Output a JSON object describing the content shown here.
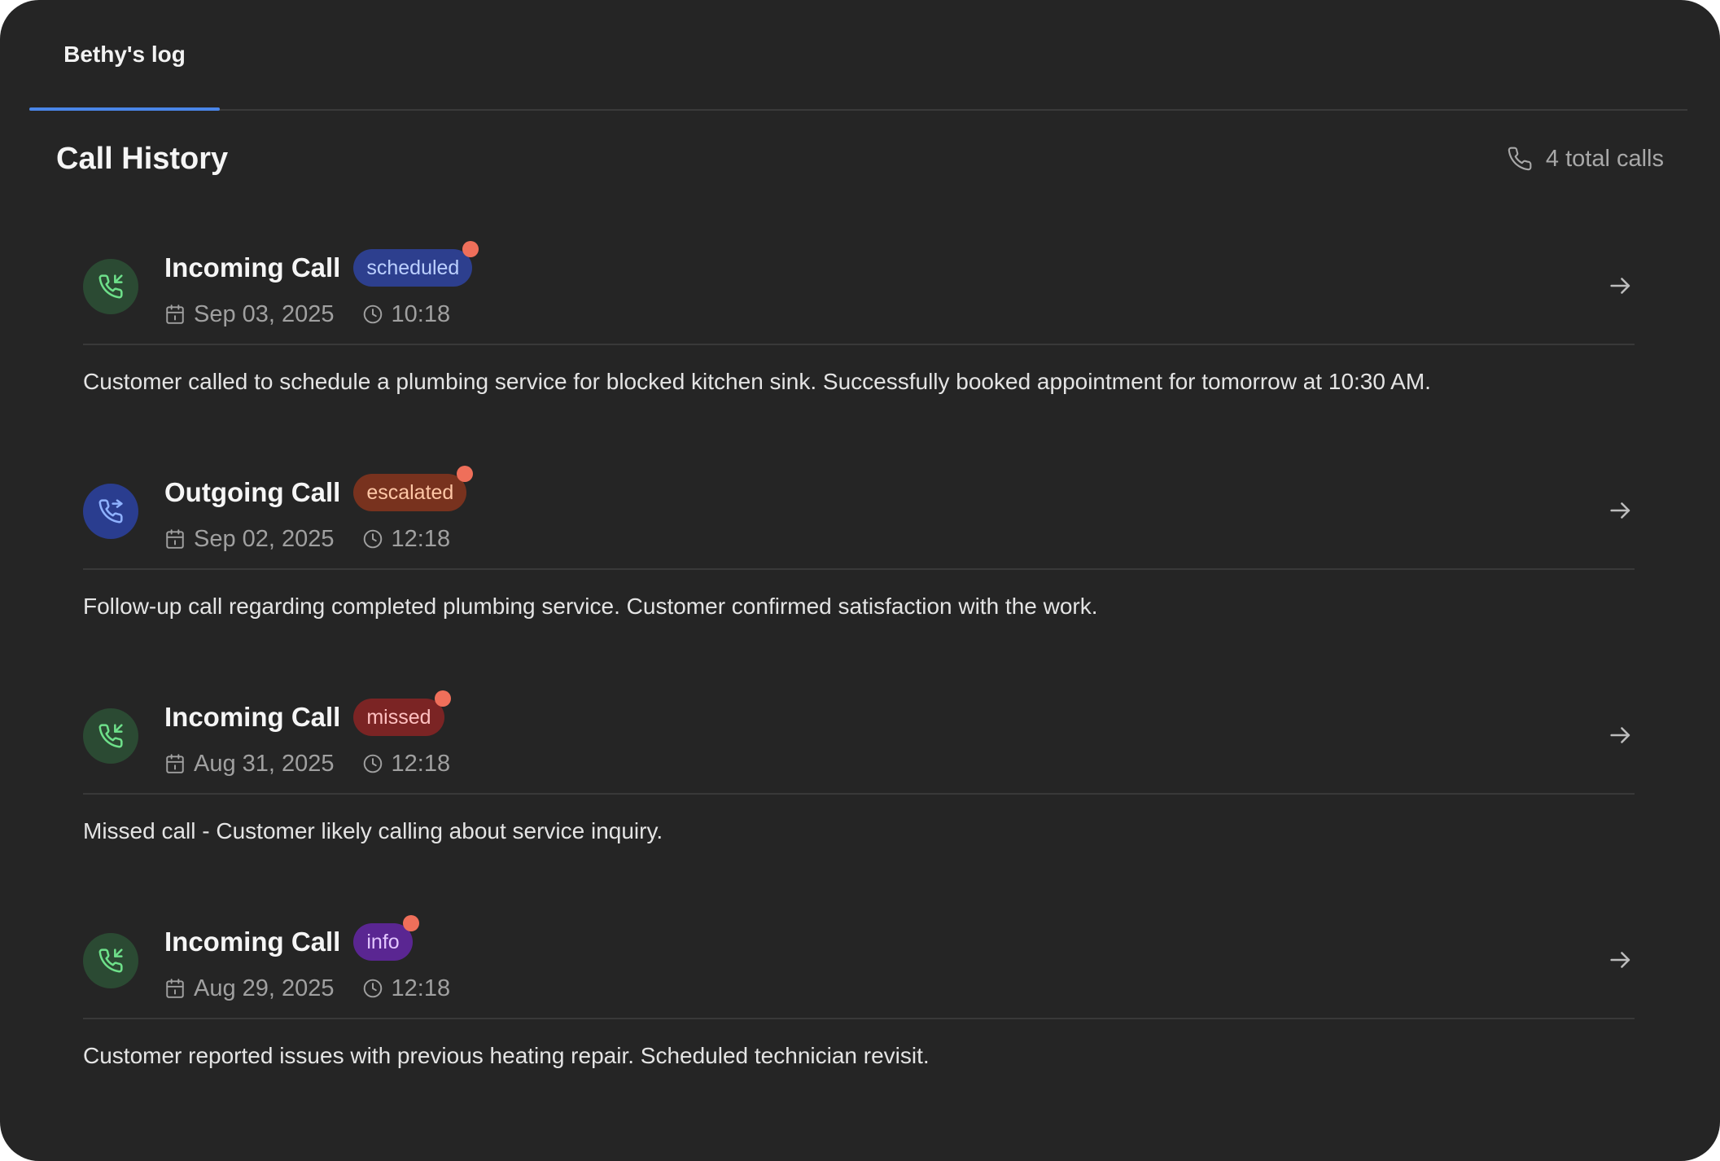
{
  "tabs": [
    {
      "label": "Bethy's log",
      "active": true
    }
  ],
  "header": {
    "title": "Call History",
    "total_calls": "4 total calls",
    "icon": "phone-icon"
  },
  "colors": {
    "panel_bg": "#252525",
    "tab_underline": "#4a86e8",
    "incoming_icon": "#6ee08a",
    "outgoing_icon": "#8fb2ff",
    "notification_dot": "#ef6f5a"
  },
  "calls": [
    {
      "type": "Incoming Call",
      "direction": "incoming",
      "status": "scheduled",
      "date": "Sep 03, 2025",
      "time": "10:18",
      "description": "Customer called to schedule a plumbing service for blocked kitchen sink. Successfully booked appointment for tomorrow at 10:30 AM."
    },
    {
      "type": "Outgoing Call",
      "direction": "outgoing",
      "status": "escalated",
      "date": "Sep 02, 2025",
      "time": "12:18",
      "description": "Follow-up call regarding completed plumbing service. Customer confirmed satisfaction with the work."
    },
    {
      "type": "Incoming Call",
      "direction": "incoming",
      "status": "missed",
      "date": "Aug 31, 2025",
      "time": "12:18",
      "description": "Missed call - Customer likely calling about service inquiry."
    },
    {
      "type": "Incoming Call",
      "direction": "incoming",
      "status": "info",
      "date": "Aug 29, 2025",
      "time": "12:18",
      "description": "Customer reported issues with previous heating repair. Scheduled technician revisit."
    }
  ]
}
